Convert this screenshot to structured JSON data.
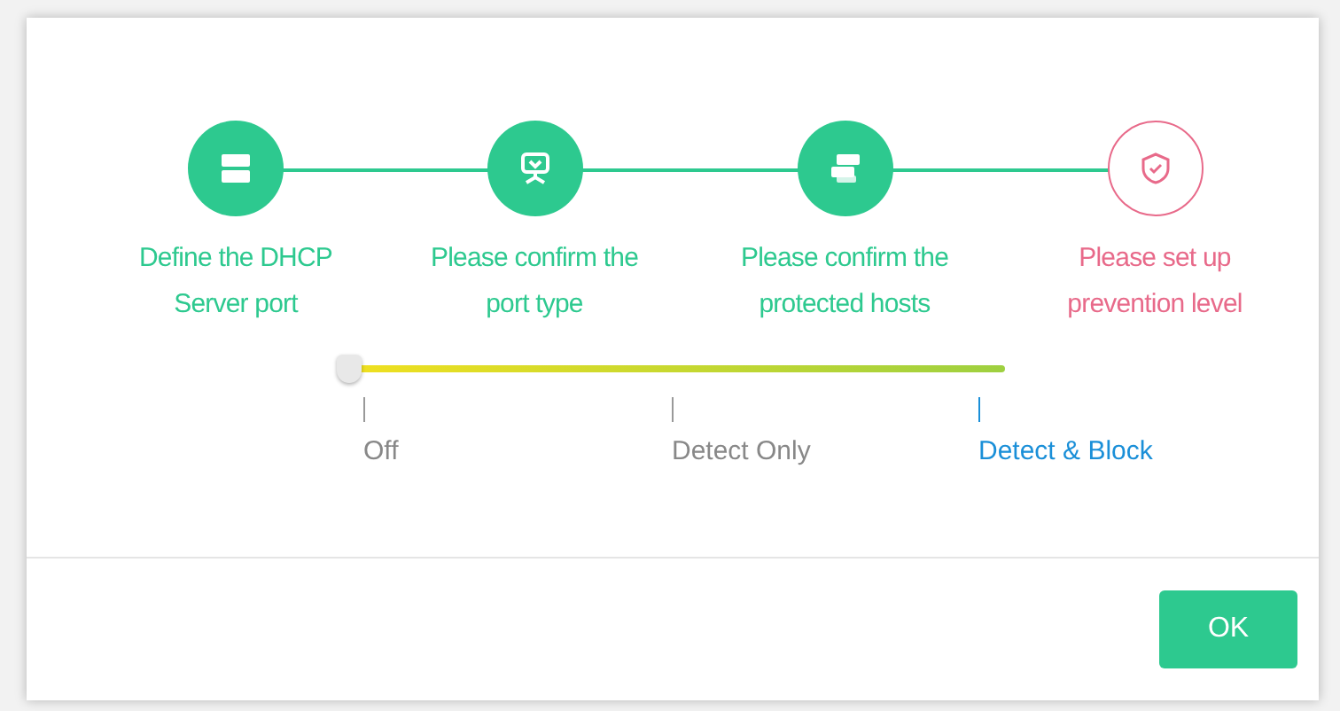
{
  "steps": [
    {
      "label": "Define the DHCP Server port",
      "completed": true,
      "kind": "server"
    },
    {
      "label": "Please confirm the port type",
      "completed": true,
      "kind": "port"
    },
    {
      "label": "Please confirm the protected hosts",
      "completed": true,
      "kind": "hosts"
    },
    {
      "label": "Please set up prevention level",
      "completed": false,
      "kind": "shield"
    }
  ],
  "prevention_slider": {
    "level": 0,
    "options": [
      {
        "label": "Off",
        "selected": false
      },
      {
        "label": "Detect Only",
        "selected": false
      },
      {
        "label": "Detect & Block",
        "selected": true
      }
    ]
  },
  "buttons": [
    {
      "label": "OK"
    }
  ]
}
